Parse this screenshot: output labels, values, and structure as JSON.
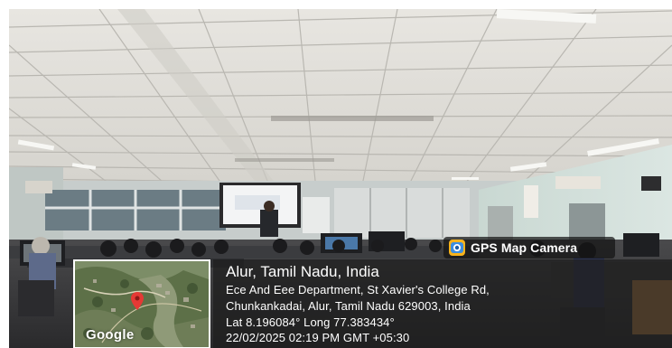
{
  "badge": {
    "label": "GPS Map Camera"
  },
  "map": {
    "logo_text": "Google"
  },
  "location": {
    "title": "Alur, Tamil Nadu, India",
    "address_line1": "Ece And Eee Department, St Xavier's College Rd,",
    "address_line2": "Chunkankadai, Alur, Tamil Nadu 629003, India",
    "coordinates": "Lat 8.196084° Long 77.383434°",
    "timestamp": "22/02/2025 02:19 PM GMT +05:30"
  },
  "colors": {
    "badge_bg": "#141414",
    "info_bg": "#1e1e1e",
    "map_pin": "#e53935",
    "map_green": "#4f6b3d"
  }
}
